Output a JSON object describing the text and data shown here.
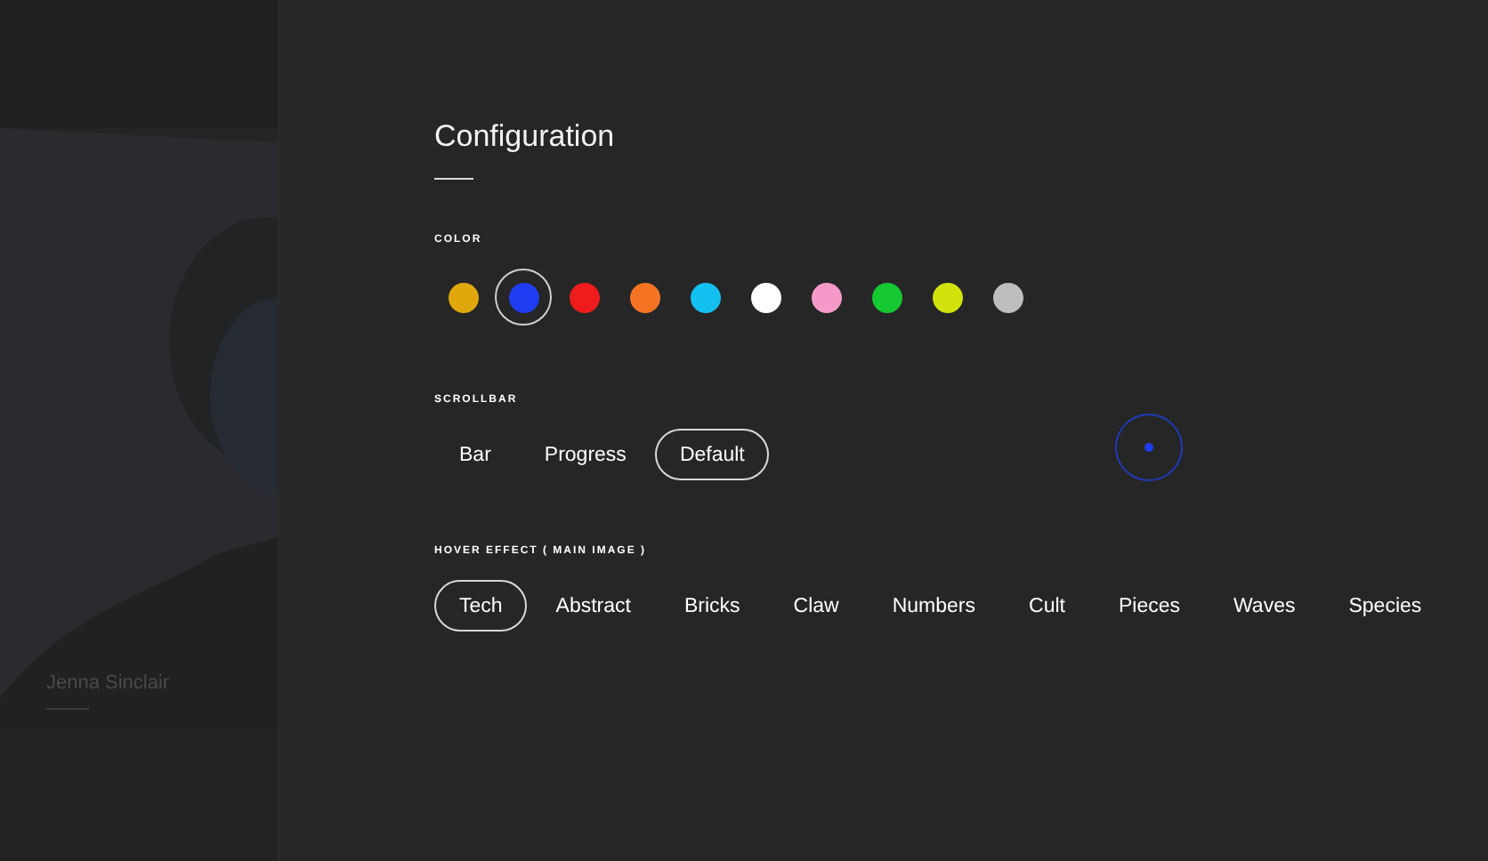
{
  "profile": {
    "caption": "Jenna Sinclair"
  },
  "title": "Configuration",
  "color": {
    "label": "COLOR",
    "swatches": [
      {
        "color": "#e0a80c",
        "selected": false
      },
      {
        "color": "#1f3df0",
        "selected": true
      },
      {
        "color": "#ee1c1c",
        "selected": false
      },
      {
        "color": "#f57424",
        "selected": false
      },
      {
        "color": "#14c0f0",
        "selected": false
      },
      {
        "color": "#ffffff",
        "selected": false
      },
      {
        "color": "#f59ac8",
        "selected": false
      },
      {
        "color": "#16c832",
        "selected": false
      },
      {
        "color": "#d2e20c",
        "selected": false
      },
      {
        "color": "#bdbdbd",
        "selected": false
      }
    ]
  },
  "scrollbar": {
    "label": "SCROLLBAR",
    "options": [
      {
        "label": "Bar",
        "selected": false
      },
      {
        "label": "Progress",
        "selected": false
      },
      {
        "label": "Default",
        "selected": true
      }
    ]
  },
  "hover_effect": {
    "label": "HOVER EFFECT ( MAIN IMAGE )",
    "options": [
      {
        "label": "Tech",
        "selected": true
      },
      {
        "label": "Abstract",
        "selected": false
      },
      {
        "label": "Bricks",
        "selected": false
      },
      {
        "label": "Claw",
        "selected": false
      },
      {
        "label": "Numbers",
        "selected": false
      },
      {
        "label": "Cult",
        "selected": false
      },
      {
        "label": "Pieces",
        "selected": false
      },
      {
        "label": "Waves",
        "selected": false
      },
      {
        "label": "Species",
        "selected": false
      }
    ]
  }
}
